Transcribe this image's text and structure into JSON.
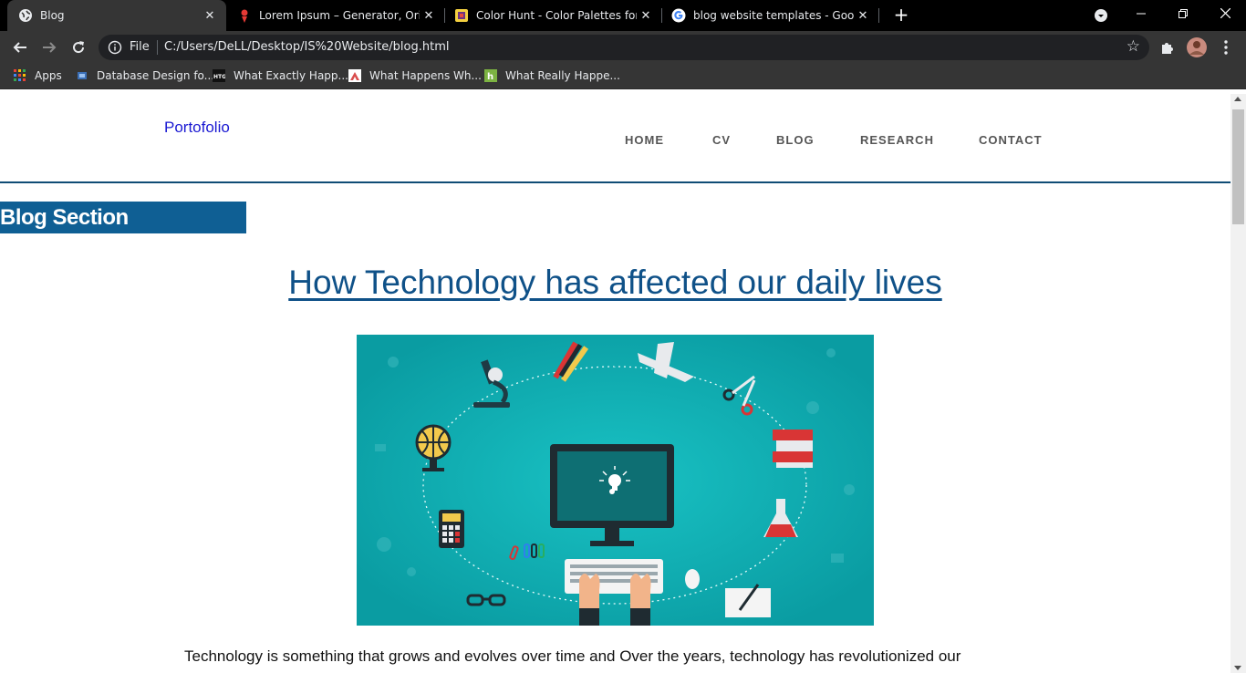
{
  "browser": {
    "tabs": [
      {
        "title": "Blog",
        "active": true,
        "icon": "globe-icon"
      },
      {
        "title": "Lorem Ipsum – Generator, Origin",
        "active": false,
        "icon": "lorem-ipsum-icon"
      },
      {
        "title": "Color Hunt - Color Palettes for De",
        "active": false,
        "icon": "color-hunt-icon"
      },
      {
        "title": "blog website templates - Google",
        "active": false,
        "icon": "google-icon"
      }
    ],
    "new_tab_symbol": "+",
    "address": {
      "scheme_label": "File",
      "url": "C:/Users/DeLL/Desktop/IS%20Website/blog.html"
    },
    "bookmarks": [
      {
        "label": "Apps",
        "icon": "apps-grid-icon"
      },
      {
        "label": "Database Design fo...",
        "icon": "database-icon"
      },
      {
        "label": "What Exactly Happ...",
        "icon": "htg-icon"
      },
      {
        "label": "What Happens Wh...",
        "icon": "triangle-logo-icon"
      },
      {
        "label": "What Really Happe...",
        "icon": "h-logo-icon"
      }
    ]
  },
  "site": {
    "brand": "Portofolio",
    "nav": [
      "HOME",
      "CV",
      "BLOG",
      "RESEARCH",
      "CONTACT"
    ],
    "section_title": "Blog Section",
    "post": {
      "title": "How Technology has affected our daily lives",
      "image_alt": "technology illustration",
      "text": "Technology is something that grows and evolves over time and Over the years, technology has revolutionized our"
    }
  },
  "colors": {
    "accent": "#0f5f94",
    "title": "#0f5188",
    "brand": "#1a19d2",
    "hero_bg": "#0ca9ad"
  }
}
